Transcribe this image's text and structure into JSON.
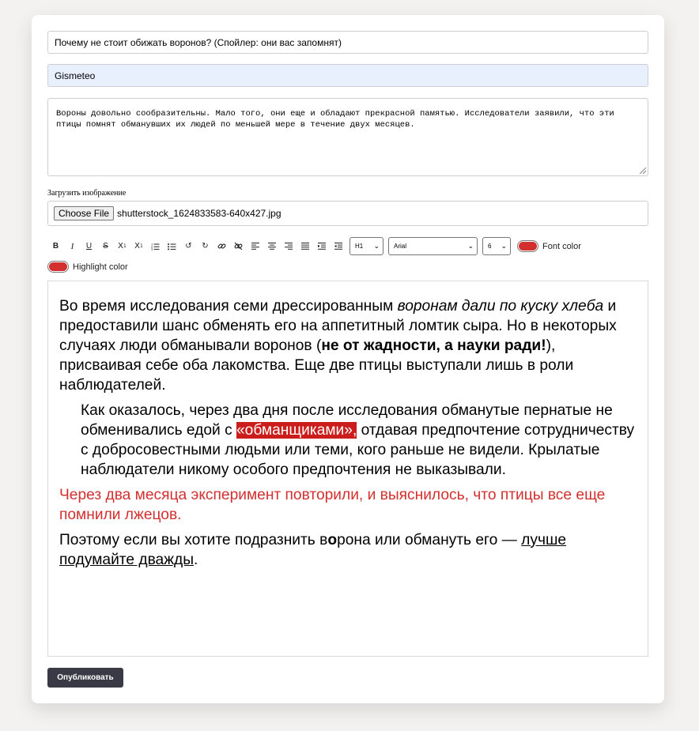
{
  "form": {
    "title_value": "Почему не стоит обижать воронов? (Спойлер: они вас запомнят)",
    "source_value": "Gismeteo",
    "summary_value": "Вороны довольно сообразительны. Мало того, они еще и обладают прекрасной памятью. Исследователи заявили, что эти птицы помнят обманувших их людей по меньшей мере в течение двух месяцев.",
    "upload_label": "Загрузить изображение",
    "choose_file_label": "Choose File",
    "file_name": "shutterstock_1624833583-640x427.jpg"
  },
  "toolbar": {
    "icons": [
      "bold-icon",
      "italic-icon",
      "underline-icon",
      "strikethrough-icon",
      "superscript-icon",
      "subscript-icon",
      "ordered-list-icon",
      "unordered-list-icon",
      "undo-icon",
      "redo-icon",
      "link-icon",
      "unlink-icon",
      "align-left-icon",
      "align-center-icon",
      "align-right-icon",
      "align-justify-icon",
      "indent-icon",
      "outdent-icon"
    ],
    "heading_select": "H1",
    "font_select": "Arial",
    "size_select": "6",
    "font_color_label": "Font color",
    "highlight_color_label": "Highlight color",
    "font_color": "#d32f2f",
    "highlight_color": "#d32f2f"
  },
  "editor": {
    "p1_a": "Во время исследования семи дрессированным ",
    "p1_italic": "воронам дали по куску хлеба",
    "p1_b": " и предоставили шанс обменять его на аппетитный ломтик сыра. Но в некоторых случаях люди обманывали воронов (",
    "p1_bold": "не от жадности, а науки ради!",
    "p1_c": "), присваивая себе оба лакомства. Еще две птицы выступали лишь в роли наблюдателей.",
    "p2_a": "Как оказалось, через два дня после исследования обманутые пернатые не обменивались едой с ",
    "p2_highlight": "«обманщиками»,",
    "p2_b": " отдавая предпочтение сотрудничеству с добросовестными людьми или теми, кого раньше не видели. Крылатые наблюдатели никому особого предпочтения не выказывали.",
    "p3": "Через два месяца эксперимент повторили, и выяснилось, что птицы все еще помнили лжецов.",
    "p4_a": "Поэтому если вы хотите подразнить в",
    "p4_bold_o": "о",
    "p4_b": "рона или обмануть его — ",
    "p4_underline": "лучше подумайте дважды",
    "p4_c": ".",
    "text_red": "#d32f2f",
    "highlight_bg": "#cc1d1d"
  },
  "publish_label": "Опубликовать"
}
